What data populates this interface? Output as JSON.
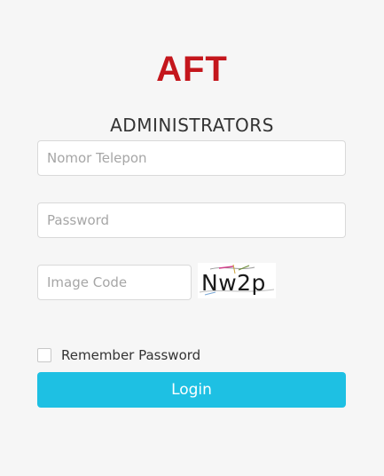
{
  "brand": {
    "logo_text": "AFT",
    "logo_color": "#c4161c"
  },
  "page": {
    "heading": "ADMINISTRATORS"
  },
  "form": {
    "phone_placeholder": "Nomor Telepon",
    "password_placeholder": "Password",
    "image_code_placeholder": "Image Code",
    "captcha_text": "Nw2p",
    "remember_label": "Remember Password",
    "remember_checked": false,
    "login_label": "Login"
  },
  "colors": {
    "accent": "#1ec0e3",
    "background": "#f6f6f6"
  }
}
